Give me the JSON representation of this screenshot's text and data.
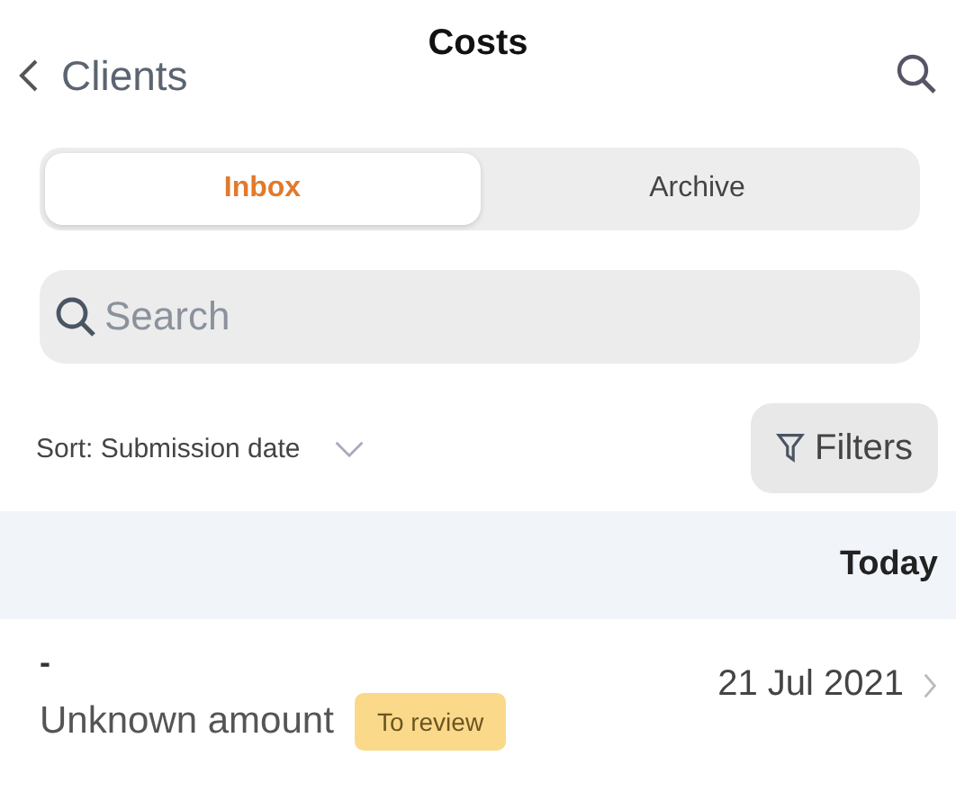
{
  "header": {
    "back_label": "Clients",
    "title": "Costs"
  },
  "tabs": [
    {
      "label": "Inbox",
      "selected": true
    },
    {
      "label": "Archive",
      "selected": false
    }
  ],
  "search": {
    "placeholder": "Search"
  },
  "sort": {
    "label": "Sort: Submission date"
  },
  "filters_button": "Filters",
  "sections": [
    {
      "heading": "Today",
      "items": [
        {
          "title": "-",
          "amount": "Unknown amount",
          "badge": "To review",
          "date": "21 Jul 2021"
        }
      ]
    }
  ]
}
